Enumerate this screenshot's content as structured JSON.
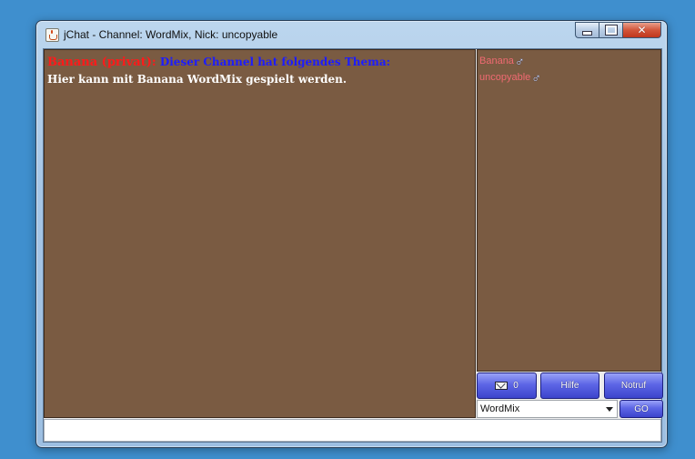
{
  "window": {
    "title": "jChat - Channel: WordMix, Nick: uncopyable"
  },
  "chat": {
    "sender": "Banana (privat):",
    "topic_intro": "Dieser Channel hat folgendes Thema:",
    "topic_text": "Hier kann mit Banana WordMix gespielt werden."
  },
  "users": [
    {
      "name": "Banana",
      "gender_icon": "male-symbol-icon"
    },
    {
      "name": "uncopyable",
      "gender_icon": "male-symbol-icon"
    }
  ],
  "buttons": {
    "mail_count": "0",
    "help_label": "Hilfe",
    "notruf_label": "Notruf",
    "go_label": "GO"
  },
  "channel_select": {
    "selected": "WordMix"
  },
  "message_input": {
    "value": ""
  },
  "colors": {
    "chat_background": "#7a5b42",
    "sender_color": "#ff1a1a",
    "topic_color": "#1c1cff",
    "username_color": "#f06a72",
    "button_blue": "#5d66e6"
  }
}
